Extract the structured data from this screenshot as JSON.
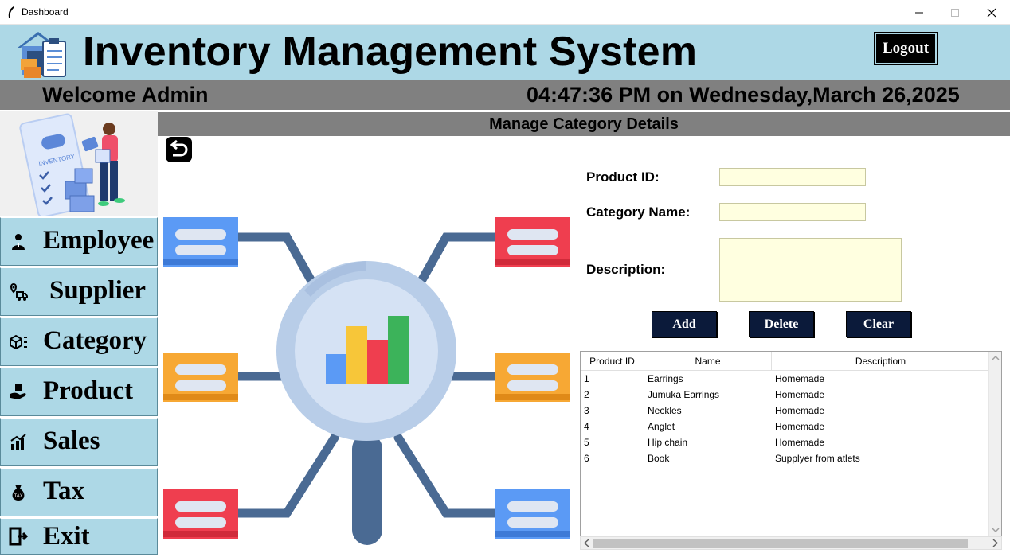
{
  "window": {
    "title": "Dashboard"
  },
  "header": {
    "title": "Inventory Management System",
    "logout_label": "Logout"
  },
  "subheader": {
    "welcome": "Welcome Admin",
    "datetime": "04:47:36 PM on Wednesday,March 26,2025"
  },
  "sidebar": {
    "items": [
      {
        "label": "Employee",
        "icon": "employee-icon"
      },
      {
        "label": "Supplier",
        "icon": "supplier-icon"
      },
      {
        "label": "Category",
        "icon": "category-icon"
      },
      {
        "label": "Product",
        "icon": "product-icon"
      },
      {
        "label": "Sales",
        "icon": "sales-icon"
      },
      {
        "label": "Tax",
        "icon": "tax-icon"
      },
      {
        "label": "Exit",
        "icon": "exit-icon"
      }
    ]
  },
  "main": {
    "section_title": "Manage Category Details",
    "form": {
      "product_id_label": "Product ID:",
      "product_id_value": "",
      "category_name_label": "Category Name:",
      "category_name_value": "",
      "description_label": "Description:",
      "description_value": ""
    },
    "buttons": {
      "add": "Add",
      "delete": "Delete",
      "clear": "Clear"
    },
    "table": {
      "columns": [
        "Product ID",
        "Name",
        "Descriptiom"
      ],
      "rows": [
        [
          "1",
          "Earrings",
          "Homemade"
        ],
        [
          "2",
          "Jumuka Earrings",
          "Homemade"
        ],
        [
          "3",
          "Neckles",
          "Homemade"
        ],
        [
          "4",
          "Anglet",
          "Homemade"
        ],
        [
          "5",
          "Hip chain",
          "Homemade"
        ],
        [
          "6",
          "Book",
          "Supplyer from atlets"
        ]
      ]
    }
  },
  "colors": {
    "header_bg": "#add8e6",
    "bar_gray": "#808080",
    "input_bg": "#ffffe0",
    "button_bg": "#0b1a3a"
  }
}
